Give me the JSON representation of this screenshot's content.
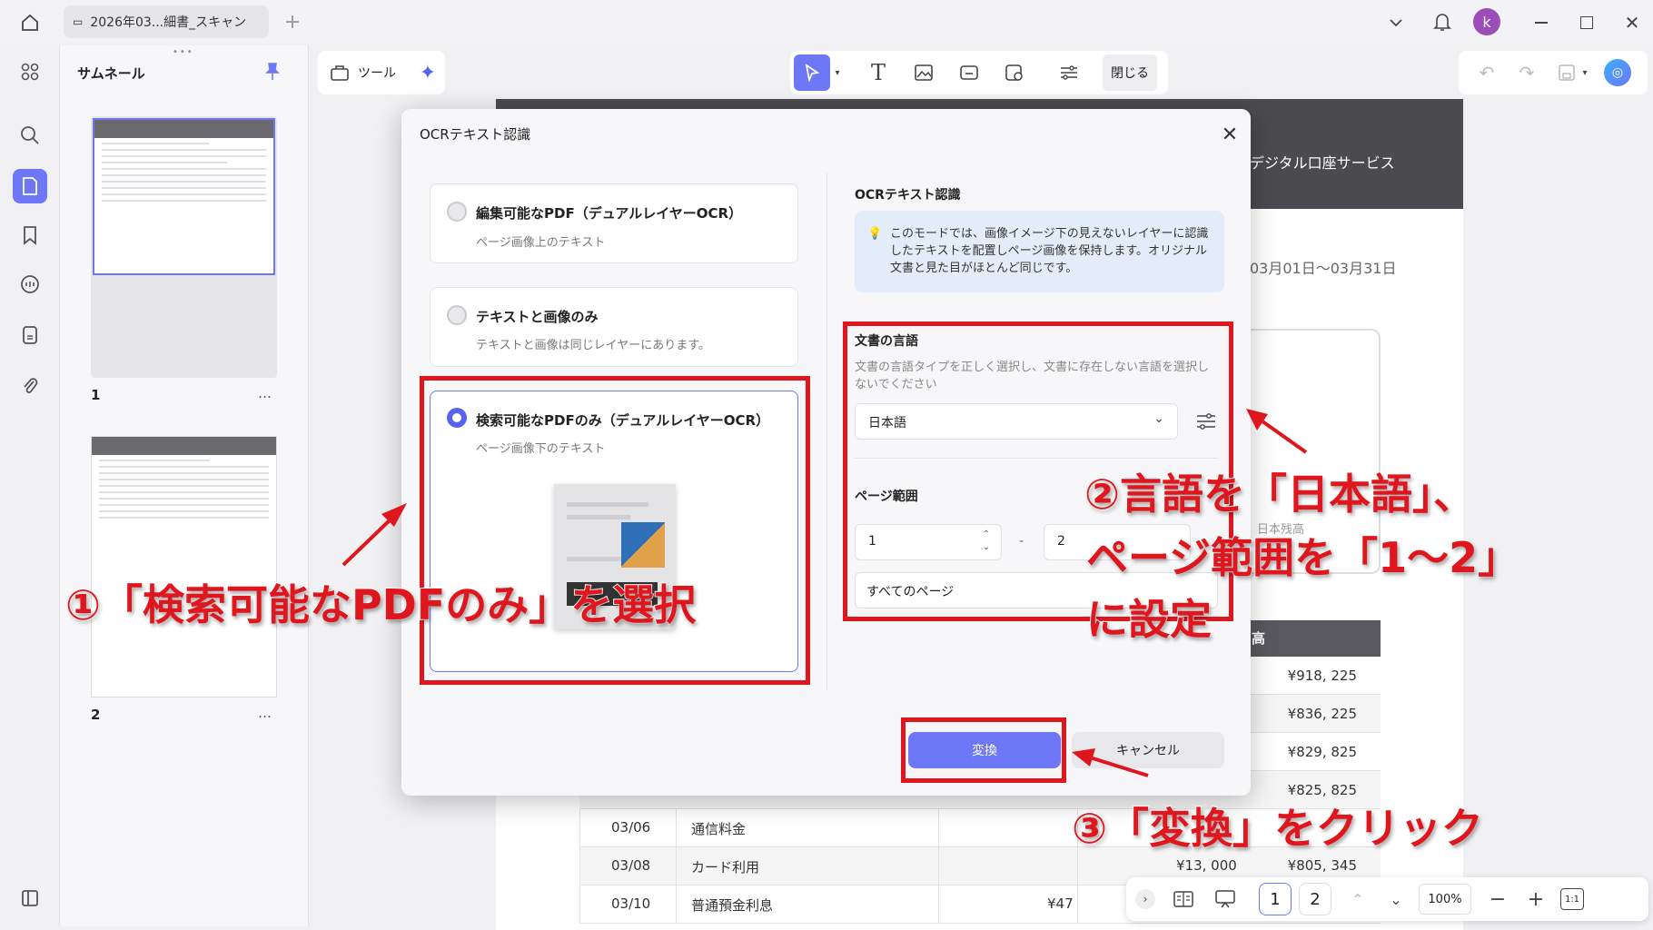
{
  "titlebar": {
    "tab_title": "2026年03...細書_スキャン",
    "avatar_letter": "k"
  },
  "thumbnails": {
    "title": "サムネール",
    "pages": [
      {
        "num": "1",
        "more": "…"
      },
      {
        "num": "2",
        "more": "…"
      }
    ]
  },
  "toolbar": {
    "tools_label": "ツール",
    "close_label": "閉じる"
  },
  "document": {
    "header_text": "デジタル口座サービス",
    "period": "03月01日～03月31日",
    "balance_header": "高",
    "balance_label": "日本残高",
    "rows": [
      {
        "date": "",
        "desc": "",
        "amount": "",
        "balance": "¥918, 225"
      },
      {
        "date": "",
        "desc": "",
        "amount": "",
        "balance": "¥836, 225"
      },
      {
        "date": "",
        "desc": "",
        "amount": "",
        "balance": "¥829, 825"
      },
      {
        "date": "",
        "desc": "",
        "amount": "",
        "balance": "¥825, 825"
      },
      {
        "date": "03/06",
        "desc": "通信料金",
        "amount": "",
        "balance": ""
      },
      {
        "date": "03/08",
        "desc": "カード利用",
        "amount": "¥13, 000",
        "balance": "¥805, 345"
      },
      {
        "date": "03/10",
        "desc": "普通預金利息",
        "amount": "¥47",
        "balance": ""
      }
    ]
  },
  "dialog": {
    "title": "OCRテキスト認識",
    "options": [
      {
        "title": "編集可能なPDF（デュアルレイヤーOCR）",
        "sub": "ページ画像上のテキスト"
      },
      {
        "title": "テキストと画像のみ",
        "sub": "テキストと画像は同じレイヤーにあります。"
      },
      {
        "title": "検索可能なPDFのみ（デュアルレイヤーOCR）",
        "sub": "ページ画像下のテキスト"
      }
    ],
    "right_title": "OCRテキスト認識",
    "info": "このモードでは、画像イメージ下の見えないレイヤーに認識したテキストを配置しページ画像を保持します。オリジナル文書と見た目がほとんど同じです。",
    "lang_label": "文書の言語",
    "lang_desc": "文書の言語タイプを正しく選択し、文書に存在しない言語を選択しないでください",
    "lang_value": "日本語",
    "range_label": "ページ範囲",
    "range_from": "1",
    "range_sep": "-",
    "range_to": "2",
    "range_select": "すべてのページ",
    "convert": "変換",
    "cancel": "キャンセル"
  },
  "annotations": {
    "step1": "①「検索可能なPDFのみ」を選択",
    "step2_line1": "②言語を「日本語」、",
    "step2_line2": "ページ範囲を「1～2」",
    "step2_line3": "に設定",
    "step3": "③「変換」をクリック"
  },
  "bottombar": {
    "page1": "1",
    "page2": "2",
    "zoom": "100%",
    "fit": "1:1"
  },
  "colors": {
    "accent": "#6e77f5",
    "annotation_red": "#e0161f"
  }
}
